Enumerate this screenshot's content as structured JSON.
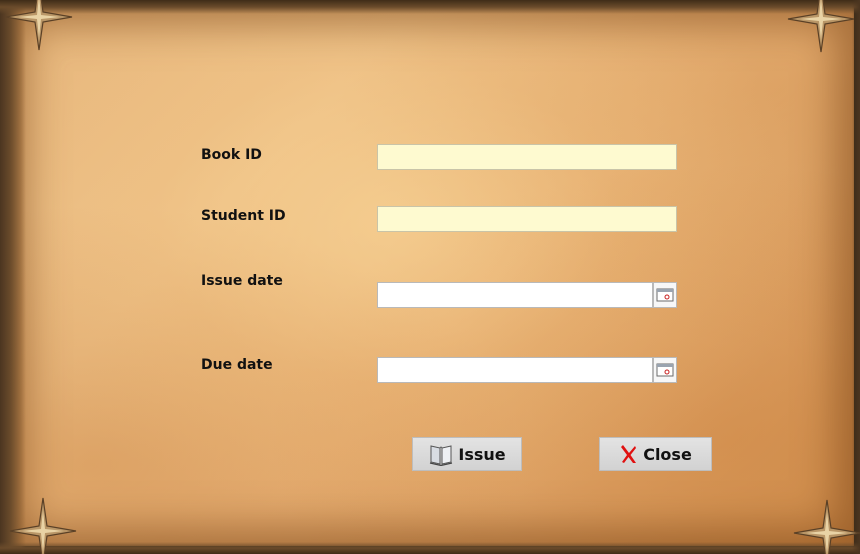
{
  "form": {
    "book_id": {
      "label": "Book ID",
      "value": ""
    },
    "student_id": {
      "label": "Student ID",
      "value": ""
    },
    "issue_date": {
      "label": "Issue date",
      "value": ""
    },
    "due_date": {
      "label": "Due date",
      "value": ""
    }
  },
  "buttons": {
    "issue_label": "Issue",
    "close_label": "Close"
  },
  "icons": {
    "issue": "book-icon",
    "close": "red-x-icon",
    "calendar": "calendar-icon",
    "decoration": "star-ornament-icon"
  },
  "colors": {
    "input_yellow": "#fefad0",
    "close_icon": "#e01010",
    "parchment": "#e6b57a"
  }
}
